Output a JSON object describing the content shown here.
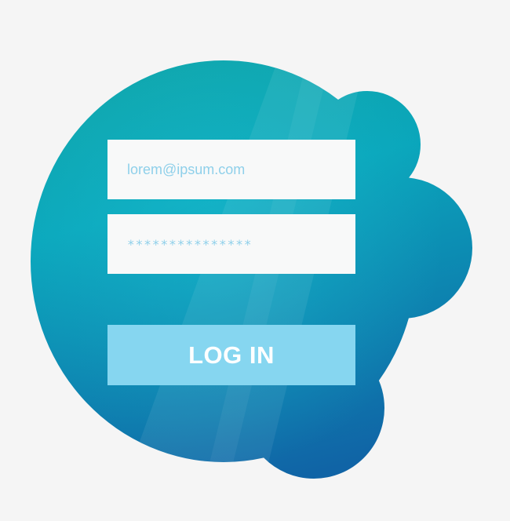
{
  "login_form": {
    "email_value": "lorem@ipsum.com",
    "password_value": "***************",
    "login_label": "LOG IN"
  },
  "colors": {
    "background": "#f5f5f5",
    "cloud_top": "#12a39e",
    "cloud_bottom": "#1064a6",
    "field_bg": "#f8f9f9",
    "field_text": "#8fd0ea",
    "button_bg": "#86d6f0",
    "button_text": "#ffffff"
  }
}
